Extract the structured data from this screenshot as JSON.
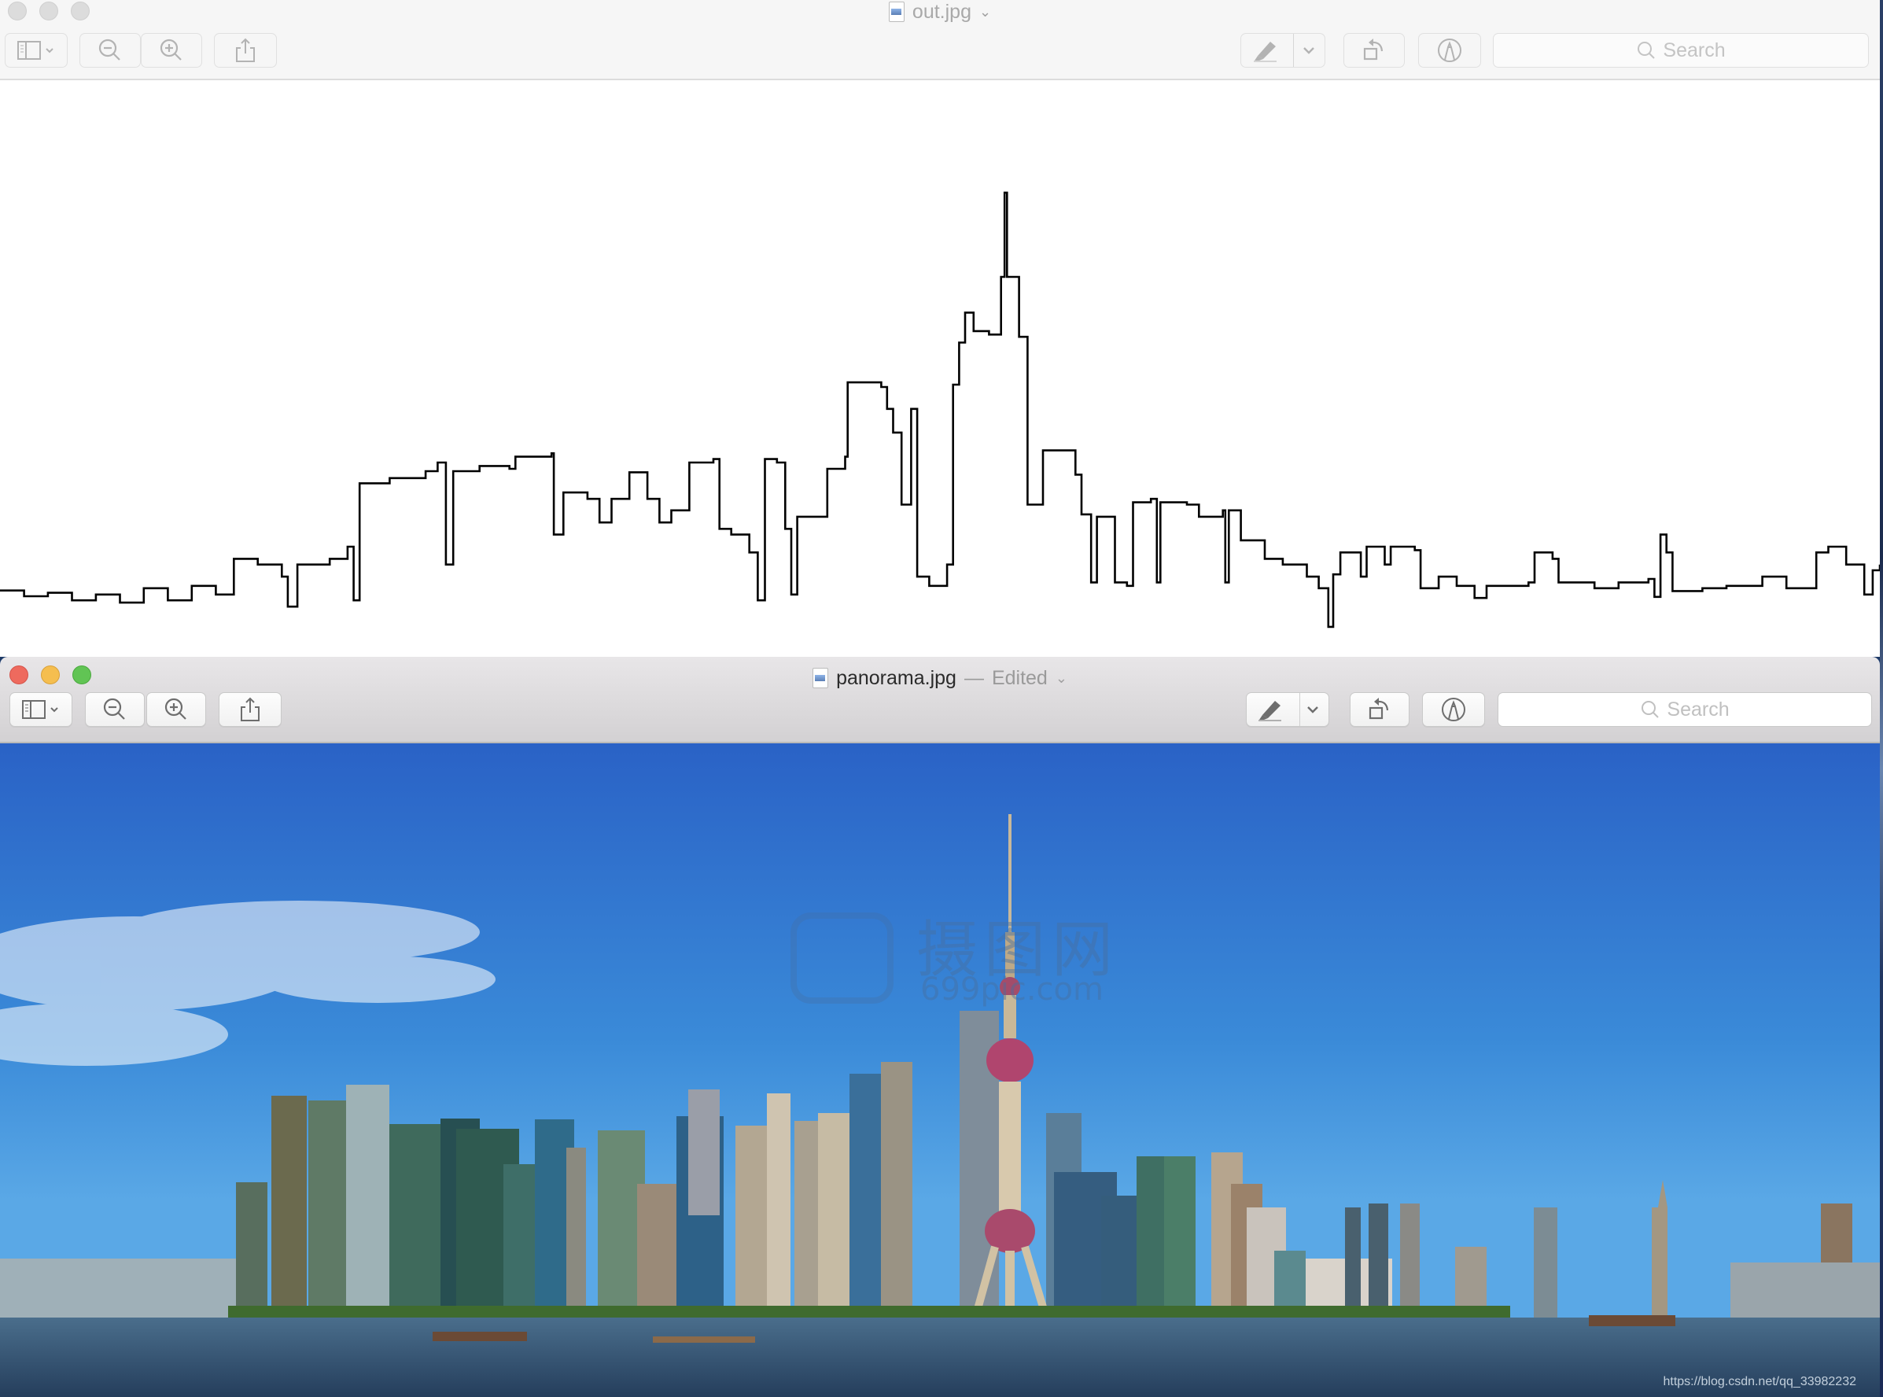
{
  "windows": {
    "top": {
      "app": "Preview",
      "state": "inactive",
      "title": "out.jpg",
      "title_chevron": "chevron-down-icon",
      "toolbar": {
        "sidebar_button": "sidebar-icon",
        "zoom_out_button": "zoom-out-icon",
        "zoom_in_button": "zoom-in-icon",
        "share_button": "share-icon",
        "highlight_button": "highlighter-icon",
        "highlight_menu": "chevron-down-icon",
        "rotate_button": "rotate-left-icon",
        "markup_button": "markup-pen-icon",
        "search_placeholder": "Search"
      },
      "image": {
        "description": "Black skyline outline profile on white background",
        "line_color": "#000000",
        "background": "#ffffff",
        "profile_points_fraction": [
          [
            0,
            0.885
          ],
          [
            0.0128,
            0.895
          ],
          [
            0.0255,
            0.889
          ],
          [
            0.0383,
            0.902
          ],
          [
            0.051,
            0.892
          ],
          [
            0.0638,
            0.906
          ],
          [
            0.0765,
            0.881
          ],
          [
            0.0893,
            0.902
          ],
          [
            0.102,
            0.877
          ],
          [
            0.1148,
            0.892
          ],
          [
            0.1244,
            0.83
          ],
          [
            0.1371,
            0.84
          ],
          [
            0.1499,
            0.861
          ],
          [
            0.1531,
            0.913
          ],
          [
            0.1582,
            0.84
          ],
          [
            0.1754,
            0.83
          ],
          [
            0.1849,
            0.809
          ],
          [
            0.1881,
            0.902
          ],
          [
            0.1913,
            0.699
          ],
          [
            0.2073,
            0.69
          ],
          [
            0.2264,
            0.678
          ],
          [
            0.2328,
            0.663
          ],
          [
            0.2372,
            0.84
          ],
          [
            0.2411,
            0.678
          ],
          [
            0.2551,
            0.669
          ],
          [
            0.271,
            0.674
          ],
          [
            0.2742,
            0.653
          ],
          [
            0.2934,
            0.647
          ],
          [
            0.2946,
            0.788
          ],
          [
            0.2997,
            0.715
          ],
          [
            0.3125,
            0.726
          ],
          [
            0.3189,
            0.767
          ],
          [
            0.3253,
            0.726
          ],
          [
            0.3348,
            0.68
          ],
          [
            0.3444,
            0.726
          ],
          [
            0.3508,
            0.767
          ],
          [
            0.3571,
            0.746
          ],
          [
            0.3667,
            0.663
          ],
          [
            0.3795,
            0.657
          ],
          [
            0.3827,
            0.778
          ],
          [
            0.389,
            0.788
          ],
          [
            0.3986,
            0.819
          ],
          [
            0.4031,
            0.902
          ],
          [
            0.4069,
            0.657
          ],
          [
            0.4133,
            0.663
          ],
          [
            0.4177,
            0.778
          ],
          [
            0.4209,
            0.892
          ],
          [
            0.4241,
            0.757
          ],
          [
            0.4401,
            0.674
          ],
          [
            0.4496,
            0.653
          ],
          [
            0.4509,
            0.524
          ],
          [
            0.4688,
            0.532
          ],
          [
            0.4719,
            0.57
          ],
          [
            0.4751,
            0.611
          ],
          [
            0.4796,
            0.736
          ],
          [
            0.4847,
            0.57
          ],
          [
            0.4879,
            0.861
          ],
          [
            0.4943,
            0.877
          ],
          [
            0.5038,
            0.84
          ],
          [
            0.507,
            0.528
          ],
          [
            0.5102,
            0.455
          ],
          [
            0.5134,
            0.403
          ],
          [
            0.5179,
            0.435
          ],
          [
            0.5261,
            0.441
          ],
          [
            0.5325,
            0.341
          ],
          [
            0.5344,
            0.195
          ],
          [
            0.5357,
            0.341
          ],
          [
            0.5421,
            0.445
          ],
          [
            0.5466,
            0.736
          ],
          [
            0.5517,
            0.736
          ],
          [
            0.5548,
            0.642
          ],
          [
            0.5676,
            0.642
          ],
          [
            0.5721,
            0.684
          ],
          [
            0.5753,
            0.753
          ],
          [
            0.5804,
            0.871
          ],
          [
            0.5835,
            0.757
          ],
          [
            0.5931,
            0.871
          ],
          [
            0.5995,
            0.877
          ],
          [
            0.6027,
            0.732
          ],
          [
            0.6122,
            0.726
          ],
          [
            0.6154,
            0.871
          ],
          [
            0.6173,
            0.732
          ],
          [
            0.6314,
            0.736
          ],
          [
            0.6378,
            0.757
          ],
          [
            0.6505,
            0.746
          ],
          [
            0.6518,
            0.871
          ],
          [
            0.6537,
            0.746
          ],
          [
            0.6601,
            0.798
          ],
          [
            0.6728,
            0.83
          ],
          [
            0.6824,
            0.84
          ],
          [
            0.6952,
            0.861
          ],
          [
            0.7015,
            0.881
          ],
          [
            0.7066,
            0.948
          ],
          [
            0.7092,
            0.857
          ],
          [
            0.713,
            0.819
          ],
          [
            0.7207,
            0.819
          ],
          [
            0.7239,
            0.861
          ],
          [
            0.727,
            0.809
          ],
          [
            0.7366,
            0.84
          ],
          [
            0.7398,
            0.809
          ],
          [
            0.7462,
            0.809
          ],
          [
            0.7526,
            0.815
          ],
          [
            0.7557,
            0.881
          ],
          [
            0.7653,
            0.861
          ],
          [
            0.7749,
            0.877
          ],
          [
            0.7844,
            0.898
          ],
          [
            0.7908,
            0.877
          ],
          [
            0.8131,
            0.871
          ],
          [
            0.8163,
            0.819
          ],
          [
            0.8259,
            0.83
          ],
          [
            0.8291,
            0.871
          ],
          [
            0.8482,
            0.881
          ],
          [
            0.861,
            0.871
          ],
          [
            0.8769,
            0.865
          ],
          [
            0.8801,
            0.896
          ],
          [
            0.8833,
            0.788
          ],
          [
            0.8865,
            0.819
          ],
          [
            0.8897,
            0.886
          ],
          [
            0.9056,
            0.881
          ],
          [
            0.9184,
            0.877
          ],
          [
            0.9375,
            0.861
          ],
          [
            0.9503,
            0.881
          ],
          [
            0.9662,
            0.819
          ],
          [
            0.9726,
            0.809
          ],
          [
            0.9821,
            0.84
          ],
          [
            0.9917,
            0.892
          ],
          [
            0.9962,
            0.85
          ],
          [
            1.0,
            0.84
          ]
        ]
      }
    },
    "bottom": {
      "app": "Preview",
      "state": "active",
      "title": "panorama.jpg",
      "title_separator": "—",
      "title_status": "Edited",
      "title_chevron": "chevron-down-icon",
      "toolbar": {
        "sidebar_button": "sidebar-icon",
        "zoom_out_button": "zoom-out-icon",
        "zoom_in_button": "zoom-in-icon",
        "share_button": "share-icon",
        "highlight_button": "highlighter-icon",
        "highlight_menu": "chevron-down-icon",
        "rotate_button": "rotate-left-icon",
        "markup_button": "markup-pen-icon",
        "search_placeholder": "Search"
      },
      "image": {
        "description": "Shanghai Pudong skyline panorama with Oriental Pearl Tower over the Huangpu river",
        "watermark_cn": "摄图网",
        "watermark_en": "699pic.com",
        "source_url_watermark": "https://blog.csdn.net/qq_33982232",
        "colors": {
          "sky_top": "#2a62c6",
          "sky_bottom": "#5aa8e6",
          "water": "#2f4a68",
          "greenery": "#3f6b2e",
          "tower_pink": "#b0456e"
        }
      }
    }
  }
}
